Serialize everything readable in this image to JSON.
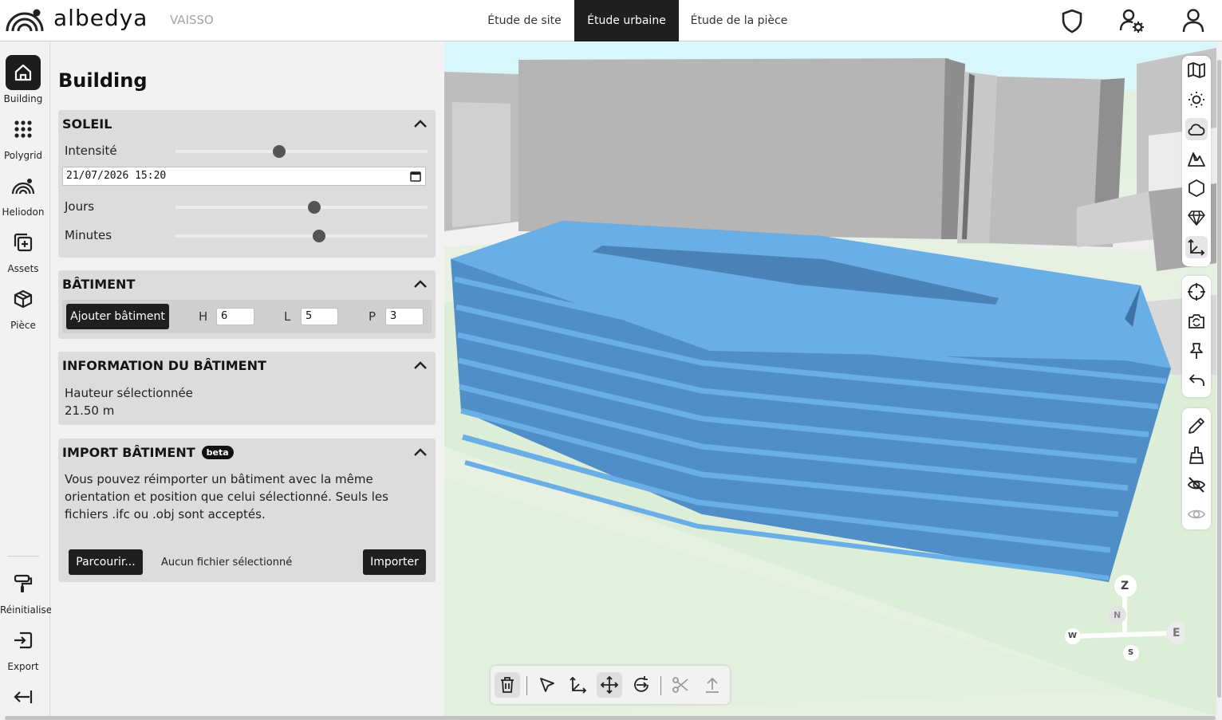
{
  "header": {
    "brand": "albedya",
    "project": "VAISSO",
    "tabs": [
      {
        "label": "Étude de site"
      },
      {
        "label": "Étude urbaine"
      },
      {
        "label": "Étude de la pièce"
      }
    ],
    "active_tab": "Étude urbaine",
    "icons": [
      "shield-icon",
      "user-settings-icon",
      "user-icon"
    ]
  },
  "leftbar": {
    "items": [
      {
        "label": "Building",
        "icon": "home-icon"
      },
      {
        "label": "Polygrid",
        "icon": "grid-dots-icon"
      },
      {
        "label": "Heliodon",
        "icon": "heliodon-icon"
      },
      {
        "label": "Assets",
        "icon": "add-asset-icon"
      },
      {
        "label": "Pièce",
        "icon": "cube-icon"
      },
      {
        "label": "Réinitialiser",
        "icon": "paint-roller-icon"
      },
      {
        "label": "Export",
        "icon": "export-icon"
      }
    ],
    "collapse_icon": "collapse-left-icon"
  },
  "panel": {
    "title": "Building",
    "soleil": {
      "title": "SOLEIL",
      "intensite_label": "Intensité",
      "intensite_value": 0.41,
      "datetime": "21/07/2026 15:20",
      "jours_label": "Jours",
      "jours_value": 0.55,
      "minutes_label": "Minutes",
      "minutes_value": 0.57
    },
    "batiment": {
      "title": "BÂTIMENT",
      "add_button": "Ajouter bâtiment",
      "h_label": "H",
      "h_value": "6",
      "l_label": "L",
      "l_value": "5",
      "p_label": "P",
      "p_value": "3"
    },
    "info": {
      "title": "INFORMATION DU BÂTIMENT",
      "height_label": "Hauteur sélectionnée",
      "height_value": "21.50 m"
    },
    "import": {
      "title": "IMPORT BÂTIMENT",
      "badge": "beta",
      "description": "Vous pouvez réimporter un bâtiment avec la même orientation et position que celui sélectionné. Seuls les fichiers .ifc ou .obj sont acceptés.",
      "browse_button": "Parcourir...",
      "no_file": "Aucun fichier sélectionné",
      "import_button": "Importer"
    }
  },
  "compass": {
    "z": "Z",
    "n": "N",
    "e": "E",
    "w": "W",
    "s": "S"
  },
  "colors": {
    "building": "#5b9fdc",
    "accent": "#1f1f1f",
    "panel_card": "#dcdcdc",
    "sky": "#d9f6fb",
    "ground": "#e3f0df"
  },
  "right_toolbar": {
    "groups": [
      [
        "map-icon",
        "sun-icon",
        "cloud-icon",
        "terrain-icon",
        "hexagon-icon",
        "diamond-icon",
        "axes-icon"
      ],
      [
        "target-icon",
        "camera-switch-icon",
        "pin-icon",
        "undo-icon"
      ],
      [
        "pencil-icon",
        "broom-icon",
        "eye-off-icon",
        "eye-icon"
      ]
    ]
  },
  "bottom_toolbar": {
    "icons": [
      "trash-icon",
      "select-arrow-icon",
      "axes-move-icon",
      "move-icon",
      "rotate-icon",
      "scissors-icon",
      "upload-icon"
    ]
  }
}
